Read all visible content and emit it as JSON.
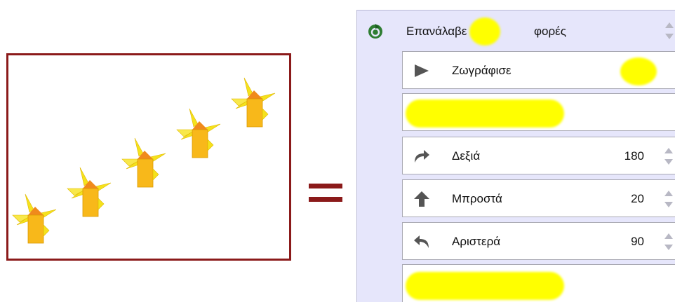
{
  "equation": {
    "symbol": "="
  },
  "drawing": {
    "count": 5,
    "border_color": "#8b1a1a"
  },
  "program": {
    "repeat": {
      "label": "Επανάλαβε",
      "suffix": "φορές",
      "icon": "repeat-icon"
    },
    "blocks": [
      {
        "id": "draw",
        "label": "Ζωγράφισε",
        "icon": "play-icon",
        "value": ""
      },
      {
        "id": "hidden1",
        "label": "",
        "icon": "",
        "value": ""
      },
      {
        "id": "right",
        "label": "Δεξιά",
        "icon": "turn-right-icon",
        "value": "180"
      },
      {
        "id": "forward",
        "label": "Μπροστά",
        "icon": "arrow-up-icon",
        "value": "20"
      },
      {
        "id": "left",
        "label": "Αριστερά",
        "icon": "turn-left-icon",
        "value": "90"
      },
      {
        "id": "hidden2",
        "label": "",
        "icon": "",
        "value": ""
      }
    ]
  },
  "colors": {
    "highlight": "#ffff00",
    "panel_bg": "#e6e6fb",
    "accent": "#8b1a1a"
  }
}
